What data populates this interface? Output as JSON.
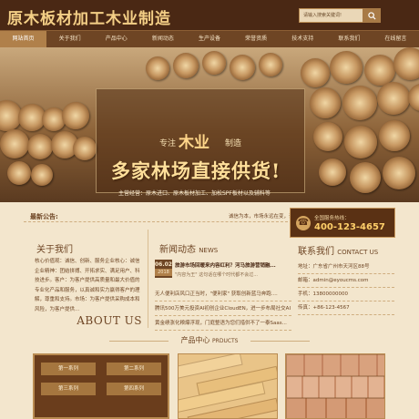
{
  "site": {
    "logo_text": "原木板材加工木业制造"
  },
  "search": {
    "placeholder": "请输入搜索关键词!",
    "button_icon": "search-icon"
  },
  "nav": {
    "items": [
      {
        "label": "网站首页",
        "active": true
      },
      {
        "label": "关于我们"
      },
      {
        "label": "产品中心"
      },
      {
        "label": "新闻动态"
      },
      {
        "label": "生产设备"
      },
      {
        "label": "荣誉资质"
      },
      {
        "label": "技术支持"
      },
      {
        "label": "联系我们"
      },
      {
        "label": "在线留言"
      }
    ]
  },
  "banner": {
    "tag_before": "专注",
    "tag_accent": "木业",
    "tag_after": "制造",
    "headline": "多家林场直接供货!",
    "subline": "主营经营：原木进口、原木板材加工、加松SPF板材以及辅料等"
  },
  "newsbar": {
    "label": "最新公告:",
    "ticker": "诚信为本，市场永远在变，诚信永远"
  },
  "hotline": {
    "label": "全国服务热线：",
    "number": "400-123-4657",
    "icon": "phone-icon"
  },
  "about": {
    "title": "关于我们",
    "text": "核心价值观：诚信、创新、服务企业核心：诚信 企业精神：团结拼搏、开拓求实、满足用户、科技进步。客户：为客户提供高质量和最大价值的专业化产品和服务，以真诚和实力赢得客户的理解，尊重和支持。市场：为客户提供采购成本和风险，为客户提供...",
    "title_en": "ABOUT US"
  },
  "news": {
    "title": "新闻动态",
    "title_en": "NEWS",
    "featured": {
      "date_day": "06.02",
      "date_year": "2018",
      "title": "旅游市场回暖来内容红利？河马旅游营销融...",
      "desc": "\"内容为王\" 这句话在哪个时代都不会过..."
    },
    "items": [
      "无人便利店风口正当时，\"便利家\" 获取创新蓝马奔跑....",
      "腾讯500万美元投资AI初创企业CloudEN，进一步布局社交AI",
      "黄金绩涨化粮爆浮现，门庭整语为您们措供不了一泰Saas..."
    ]
  },
  "contact": {
    "title": "联系我们",
    "title_en": "CONTACT US",
    "items": [
      "地址：广东省广州市天河区88号",
      "邮箱：admin@eyoucms.com",
      "手机：13800000000",
      "传真：+86-123-4567"
    ]
  },
  "products": {
    "title": "产品中心",
    "title_en": "PRDUCTS",
    "categories": [
      "第一系列",
      "第二系列",
      "第三系列",
      "第四系列"
    ]
  }
}
